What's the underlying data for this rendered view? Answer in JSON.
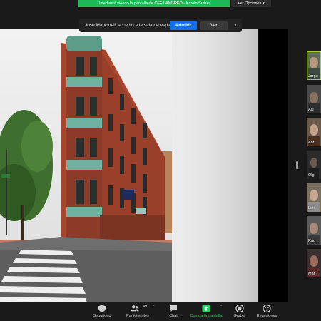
{
  "banner": {
    "share_text": "Usted está viendo la pantalla de CEF LANGREO - Karolo Suárez",
    "view_options": "Ver Opciones"
  },
  "toast": {
    "message": "Jose Mancinelli accedió a la sala de espera",
    "admit": "Admitir",
    "view": "Ver",
    "close": "×"
  },
  "gallery": {
    "tiles": [
      {
        "label": "Jorge"
      },
      {
        "label": "Aiti"
      },
      {
        "label": "Adr"
      },
      {
        "label": "Olg"
      },
      {
        "label": "Leti"
      },
      {
        "label": "Raq"
      },
      {
        "label": "Mar"
      }
    ]
  },
  "toolbar": {
    "security": "Seguridad",
    "participants": "Participantes",
    "participants_count": "49",
    "chat": "Chat",
    "share_screen": "Compartir pantalla",
    "record": "Grabar",
    "reactions": "Reacciones"
  },
  "colors": {
    "banner_green": "#1db954",
    "admit_blue": "#0e72ed",
    "share_green": "#1ed760",
    "active_tile_border": "#a6ce39"
  }
}
